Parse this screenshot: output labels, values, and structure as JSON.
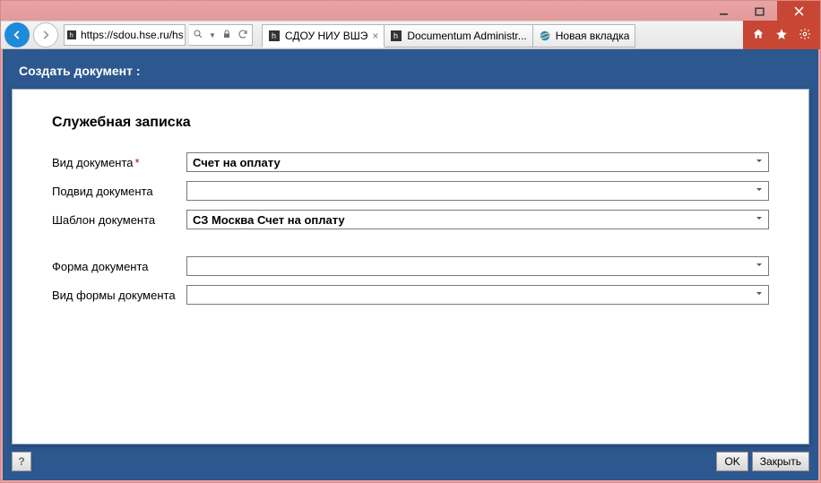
{
  "browser": {
    "url": "https://sdou.hse.ru/hs",
    "tabs": [
      {
        "label": "СДОУ НИУ ВШЭ",
        "active": true,
        "icon": "site"
      },
      {
        "label": "Documentum Administr...",
        "active": false,
        "icon": "site"
      },
      {
        "label": "Новая вкладка",
        "active": false,
        "icon": "ie"
      }
    ]
  },
  "page": {
    "title": "Создать документ :",
    "heading": "Служебная записка",
    "fields": {
      "doc_type": {
        "label": "Вид документа",
        "required": true,
        "value": "Счет на оплату"
      },
      "doc_subtype": {
        "label": "Подвид документа",
        "required": false,
        "value": ""
      },
      "doc_template": {
        "label": "Шаблон документа",
        "required": false,
        "value": "СЗ Москва Счет на оплату"
      },
      "doc_form": {
        "label": "Форма документа",
        "required": false,
        "value": ""
      },
      "doc_form_type": {
        "label": "Вид формы документа",
        "required": false,
        "value": ""
      }
    },
    "buttons": {
      "help": "?",
      "ok": "OK",
      "close": "Закрыть"
    }
  }
}
